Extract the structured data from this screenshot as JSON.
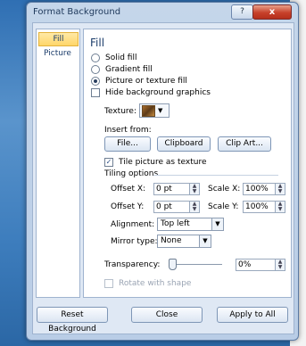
{
  "window": {
    "title": "Format Background",
    "help_glyph": "?",
    "close_glyph": "x"
  },
  "background_doc": {
    "glyph1": "i",
    "glyph2": "i"
  },
  "nav": {
    "items": [
      {
        "label": "Fill",
        "selected": true
      },
      {
        "label": "Picture",
        "selected": false
      }
    ]
  },
  "panel": {
    "heading": "Fill",
    "options": [
      {
        "label": "Solid fill",
        "checked": false
      },
      {
        "label": "Gradient fill",
        "checked": false
      },
      {
        "label": "Picture or texture fill",
        "checked": true
      }
    ],
    "hide_graphics": {
      "label": "Hide background graphics",
      "checked": false
    },
    "texture": {
      "label": "Texture:"
    },
    "insert_from": {
      "label": "Insert from:",
      "file": "File...",
      "clipboard": "Clipboard",
      "clipart": "Clip Art..."
    },
    "tile": {
      "label": "Tile picture as texture",
      "checked": true
    },
    "tiling_options": "Tiling options",
    "offset_x": {
      "label": "Offset X:",
      "value": "0 pt"
    },
    "offset_y": {
      "label": "Offset Y:",
      "value": "0 pt"
    },
    "scale_x": {
      "label": "Scale X:",
      "value": "100%"
    },
    "scale_y": {
      "label": "Scale Y:",
      "value": "100%"
    },
    "alignment": {
      "label": "Alignment:",
      "value": "Top left"
    },
    "mirror": {
      "label": "Mirror type:",
      "value": "None"
    },
    "transparency": {
      "label": "Transparency:",
      "value": "0%",
      "level": 0
    },
    "rotate": {
      "label": "Rotate with shape",
      "checked": false
    }
  },
  "footer": {
    "reset": "Reset Background",
    "close": "Close",
    "apply_all": "Apply to All"
  }
}
